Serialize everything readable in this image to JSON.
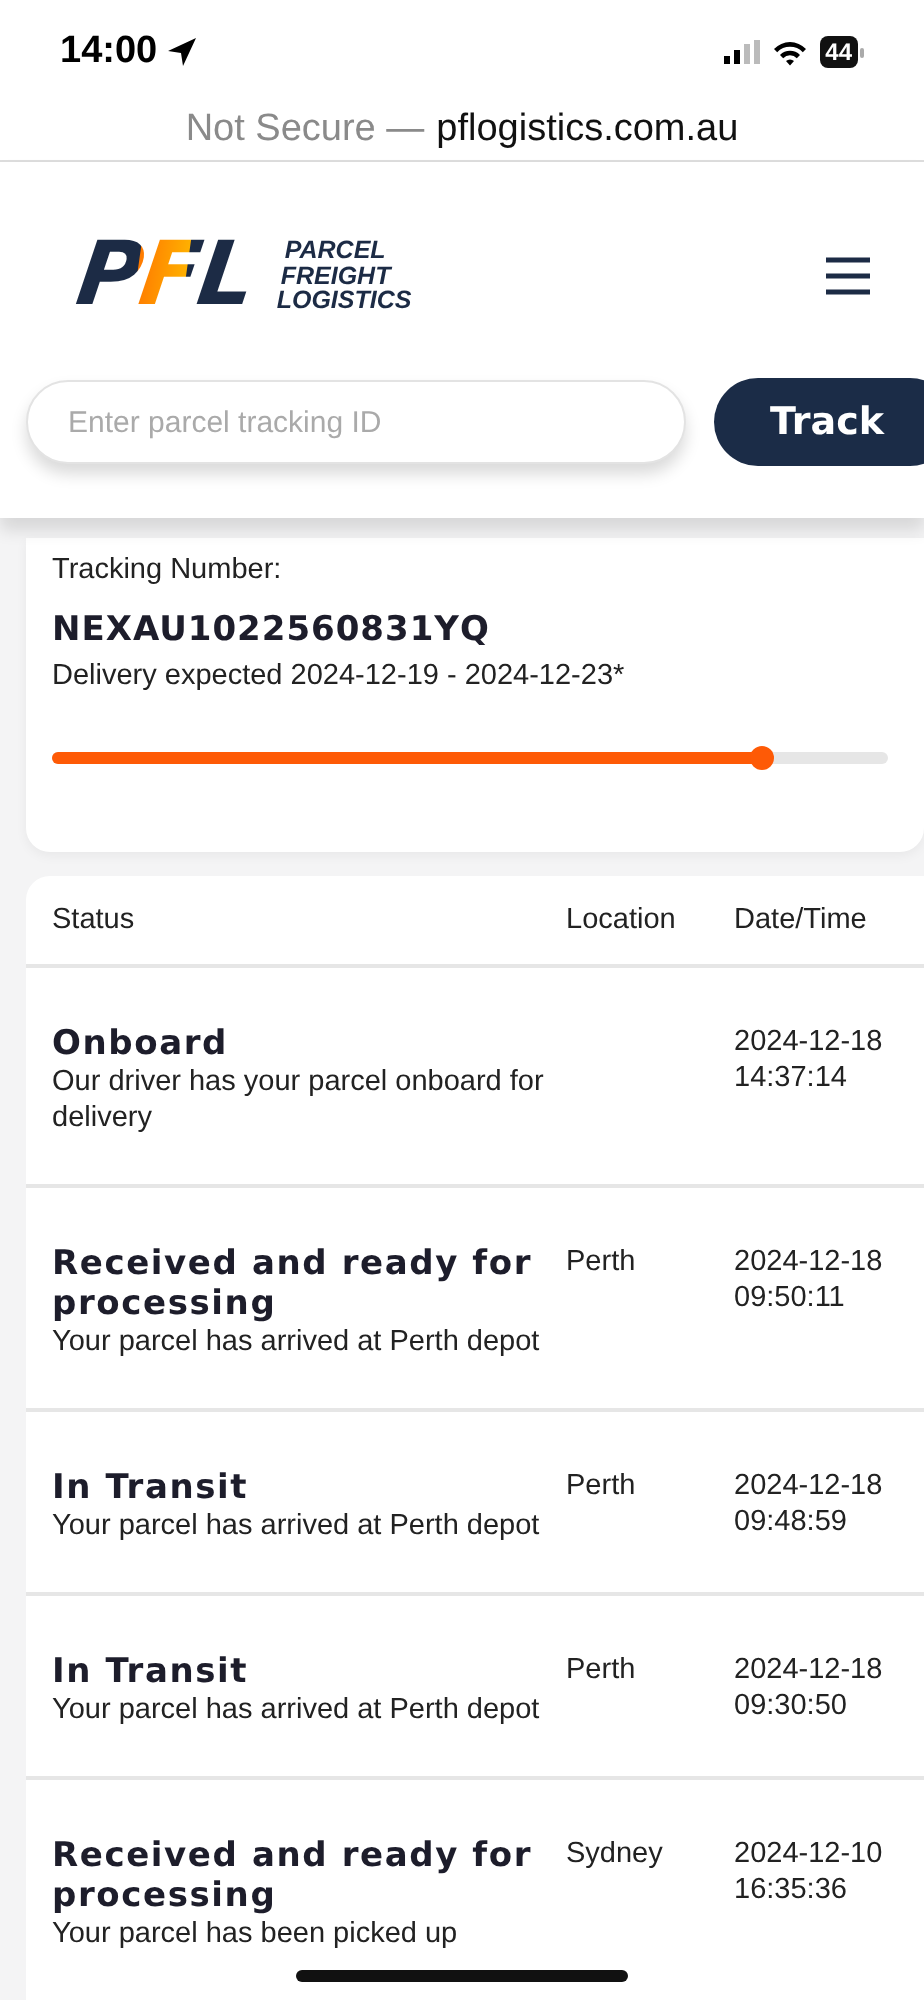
{
  "status_bar": {
    "time": "14:00",
    "battery": "44"
  },
  "url_bar": {
    "prefix": "Not Secure —",
    "domain": "pflogistics.com.au"
  },
  "header": {
    "logo_mark": "PFL",
    "logo_lines": [
      "PARCEL",
      "FREIGHT",
      "LOGISTICS"
    ]
  },
  "search": {
    "placeholder": "Enter parcel tracking ID",
    "button": "Track"
  },
  "tracking": {
    "label": "Tracking Number:",
    "number": "NEXAU1022560831YQ",
    "expected": "Delivery expected 2024-12-19 - 2024-12-23*",
    "level": 0.85
  },
  "table": {
    "columns": [
      "Status",
      "Location",
      "Date/Time"
    ],
    "rows": [
      {
        "status": "Onboard",
        "detail": "Our driver has your parcel onboard for delivery",
        "location": "",
        "datetime": "2024-12-18 14:37:14"
      },
      {
        "status": "Received and ready for processing",
        "detail": "Your parcel has arrived at Perth depot",
        "location": "Perth",
        "datetime": "2024-12-18 09:50:11"
      },
      {
        "status": "In Transit",
        "detail": "Your parcel has arrived at Perth depot",
        "location": "Perth",
        "datetime": "2024-12-18 09:48:59"
      },
      {
        "status": "In Transit",
        "detail": "Your parcel has arrived at Perth depot",
        "location": "Perth",
        "datetime": "2024-12-18 09:30:50"
      },
      {
        "status": "Received and ready for processing",
        "detail": "Your parcel has been picked up",
        "location": "Sydney",
        "datetime": "2024-12-10 16:35:36"
      }
    ]
  }
}
